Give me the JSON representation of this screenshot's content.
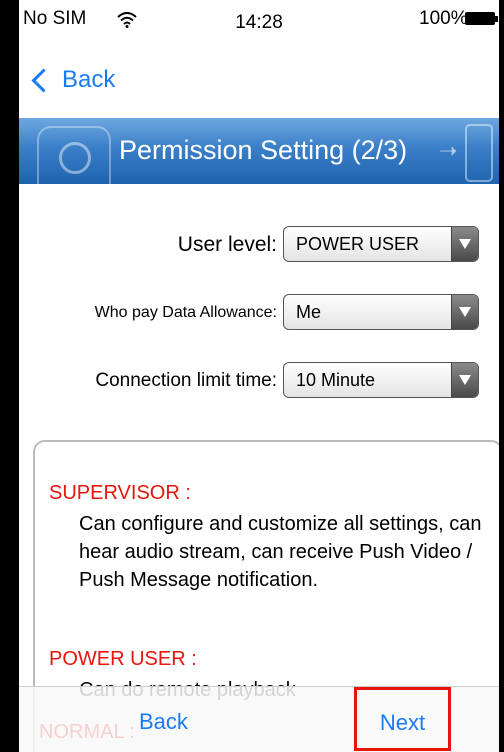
{
  "status_bar": {
    "carrier": "No SIM",
    "time": "14:28",
    "battery": "100%"
  },
  "nav": {
    "back_label": "Back"
  },
  "banner": {
    "title": "Permission Setting (2/3)"
  },
  "form": {
    "user_level": {
      "label": "User level:",
      "value": "POWER USER"
    },
    "data_allowance": {
      "label": "Who pay Data Allowance:",
      "value": "Me"
    },
    "connection_limit": {
      "label": "Connection limit time:",
      "value": "10 Minute"
    }
  },
  "descriptions": {
    "supervisor": {
      "title": "SUPERVISOR :",
      "text": "Can configure and customize all settings, can hear audio stream, can receive Push Video / Push Message notification."
    },
    "power_user": {
      "title": "POWER USER :",
      "text": "Can do remote playback"
    },
    "normal": {
      "title": "NORMAL :"
    }
  },
  "toolbar": {
    "back_label": "Back",
    "next_label": "Next"
  },
  "colors": {
    "accent": "#1a7cf4",
    "role_title": "#e8140d",
    "banner": "#2f74bf"
  }
}
